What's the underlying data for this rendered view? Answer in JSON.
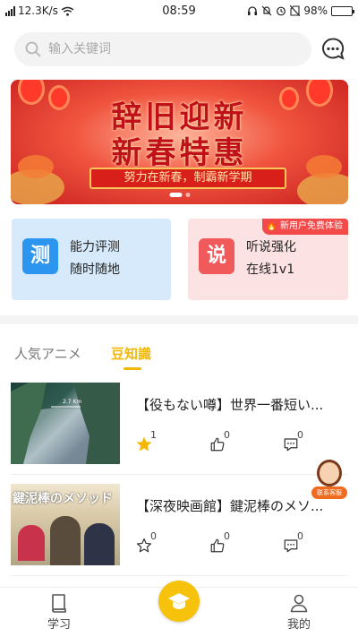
{
  "status_bar": {
    "speed": "12.3K/s",
    "time": "08:59",
    "battery": "98%",
    "battery_level": 0.98
  },
  "search": {
    "placeholder": "输入关键词"
  },
  "banner": {
    "line1": "辞旧迎新",
    "line2": "新春特惠",
    "ribbon": "努力在新春，制霸新学期"
  },
  "cards": [
    {
      "icon_char": "测",
      "title": "能力评测",
      "subtitle": "随时随地",
      "color": "#2c95f0"
    },
    {
      "icon_char": "说",
      "title": "听说强化",
      "subtitle": "在线1v1",
      "badge": "新用户免费体验",
      "color": "#f05a5a"
    }
  ],
  "tabs": [
    {
      "label": "人気アニメ",
      "active": false
    },
    {
      "label": "豆知識",
      "active": true
    }
  ],
  "articles": [
    {
      "title": "【役もない噂】世界一番短い...",
      "thumb_label": "2.7 Km",
      "stars": "1",
      "starred": true,
      "likes": "0",
      "comments": "0"
    },
    {
      "title": "【深夜映画館】鍵泥棒のメソ...",
      "thumb_label": "鍵泥棒のメソッド",
      "stars": "0",
      "starred": false,
      "likes": "0",
      "comments": "0"
    }
  ],
  "support_button": {
    "label": "联系客服"
  },
  "bottom_nav": {
    "study": "学习",
    "mine": "我的"
  },
  "colors": {
    "accent": "#f2b705",
    "nav_center": "#f6c20b"
  }
}
